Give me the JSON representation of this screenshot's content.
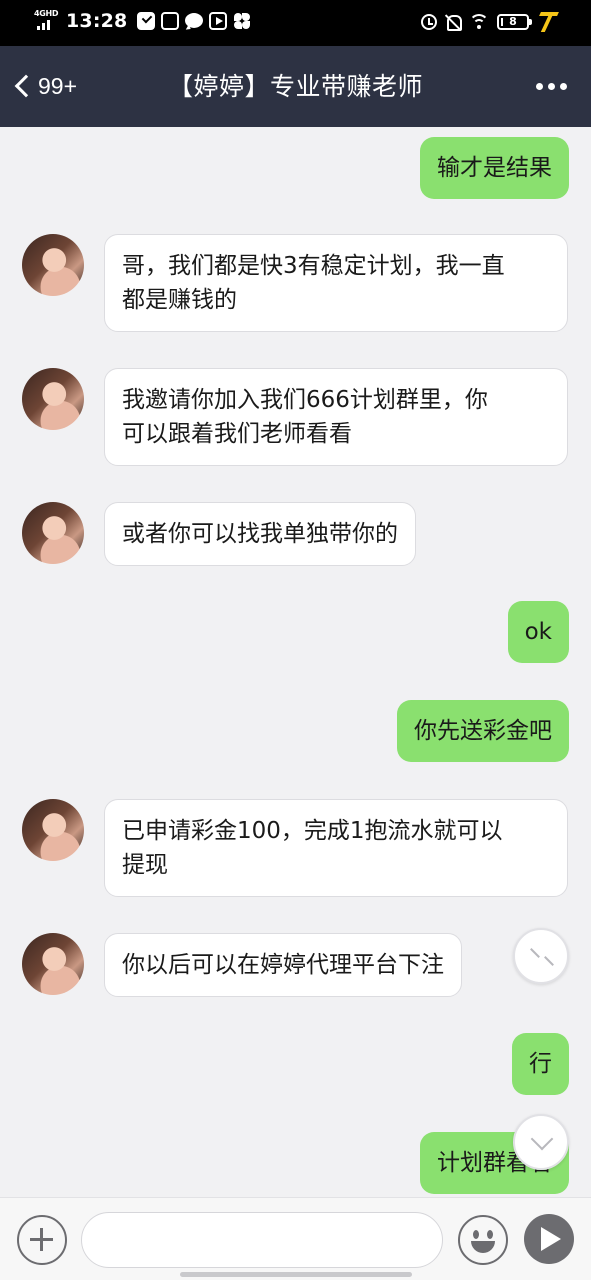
{
  "status_bar": {
    "network": "4GHD",
    "time": "13:28",
    "battery": "8",
    "battery_level": 0.08
  },
  "header": {
    "back_count": "99+",
    "title": "【婷婷】专业带赚老师"
  },
  "messages": [
    {
      "dir": "out",
      "text": "输才是结果"
    },
    {
      "dir": "in",
      "text": "哥，我们都是快3有稳定计划，我一直\n都是赚钱的"
    },
    {
      "dir": "in",
      "text": "我邀请你加入我们666计划群里，你\n可以跟着我们老师看看"
    },
    {
      "dir": "in",
      "text": "或者你可以找我单独带你的"
    },
    {
      "dir": "out",
      "text": "ok"
    },
    {
      "dir": "out",
      "text": "你先送彩金吧"
    },
    {
      "dir": "in",
      "text": "已申请彩金100，完成1抱流水就可以\n提现"
    },
    {
      "dir": "in",
      "text": "你以后可以在婷婷代理平台下注"
    },
    {
      "dir": "out",
      "text": "行"
    },
    {
      "dir": "out",
      "text": "计划群看看"
    }
  ],
  "input": {
    "placeholder": ""
  },
  "colors": {
    "nav_bg": "#2d3243",
    "outgoing_bubble": "#8ae06f",
    "incoming_bubble": "#ffffff",
    "chat_bg": "#f1f1f3"
  }
}
